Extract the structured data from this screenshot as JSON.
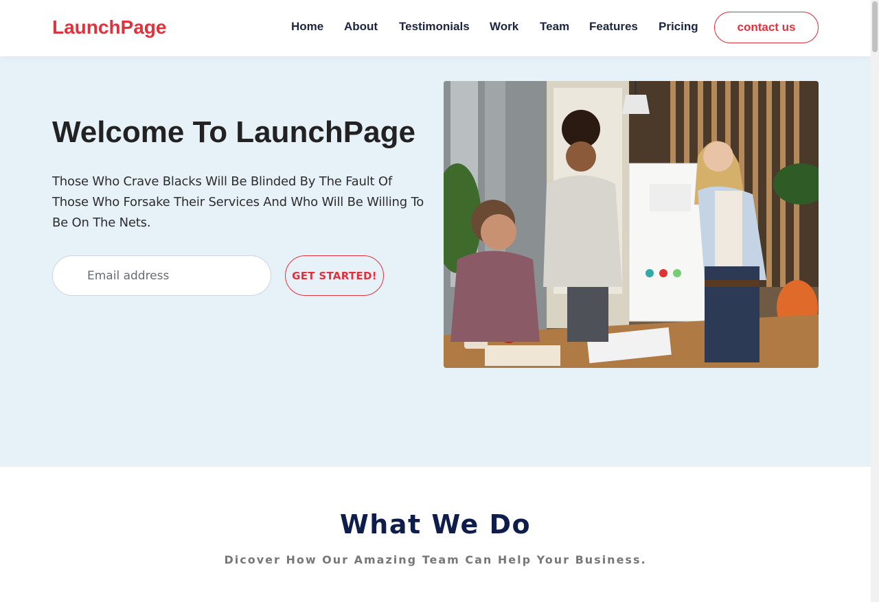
{
  "header": {
    "logo": "LaunchPage",
    "nav": [
      {
        "label": "Home"
      },
      {
        "label": "About"
      },
      {
        "label": "Testimonials"
      },
      {
        "label": "Work"
      },
      {
        "label": "Team"
      },
      {
        "label": "Features"
      },
      {
        "label": "Pricing"
      }
    ],
    "contact_label": "contact us"
  },
  "hero": {
    "title": "Welcome To LaunchPage",
    "text": "Those Who Crave Blacks Will Be Blinded By The Fault Of Those Who Forsake Their Services And Who Will Be Willing To Be On The Nets.",
    "email_placeholder": "Email address",
    "cta_label": "GET STARTED!",
    "image_icon": "team-meeting-photo"
  },
  "section": {
    "title": "What We Do",
    "subtitle": "Dicover How Our Amazing Team Can Help Your Business."
  },
  "colors": {
    "brand": "#e0323c",
    "nav_text": "#1c2540",
    "hero_bg": "#e7f1f8",
    "section_title": "#0e1d4a"
  }
}
